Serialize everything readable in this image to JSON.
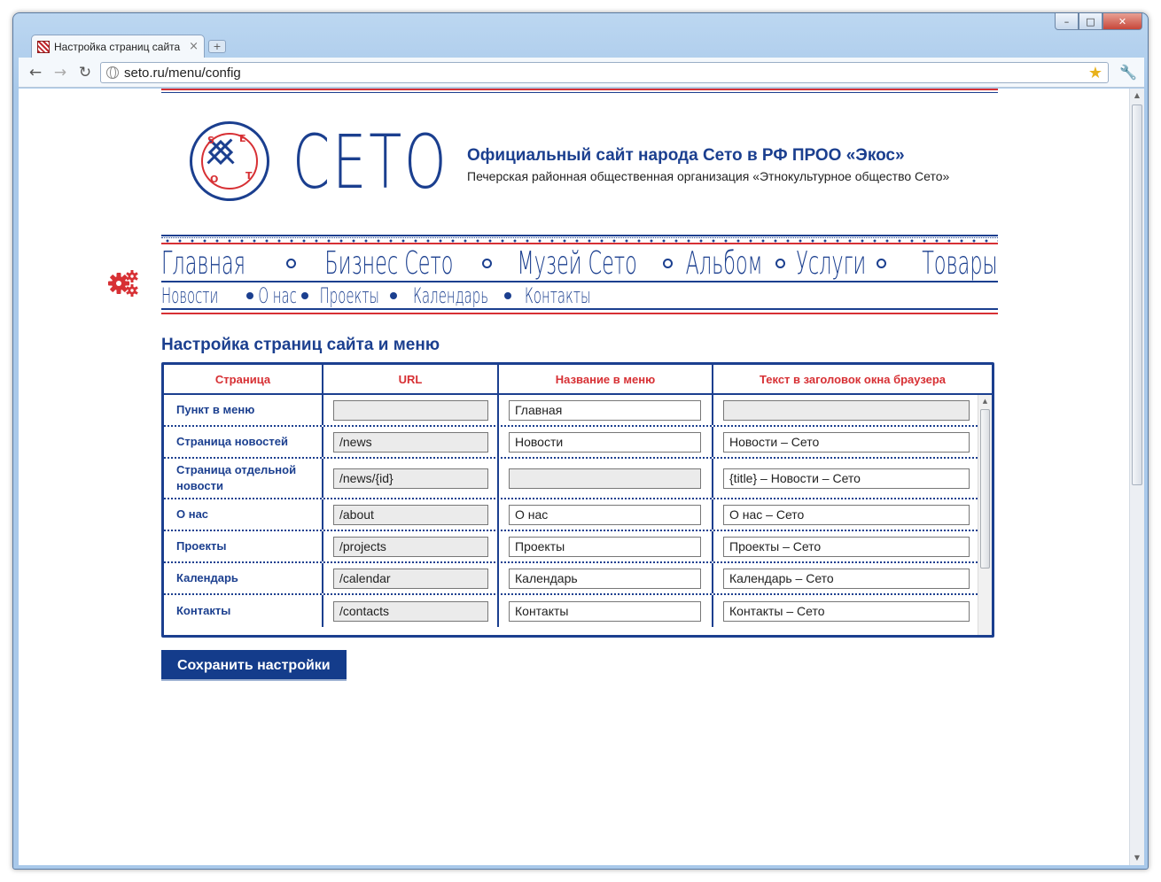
{
  "browser": {
    "tab_title": "Настройка страниц сайта",
    "tab_close": "×",
    "new_tab": "+",
    "url": "seto.ru/menu/config",
    "win_min": "–",
    "win_max": "□",
    "win_close": "✕",
    "back": "←",
    "forward": "→",
    "reload": "↻",
    "star": "★",
    "wrench": "🔧"
  },
  "site": {
    "wordmark": "СЕТО",
    "logo_letters": [
      "S",
      "E",
      "T",
      "O"
    ],
    "title": "Официальный сайт народа Сето в РФ ПРОО «Экос»",
    "subtitle": "Печерская районная общественная организация «Этнокультурное общество Сето»"
  },
  "main_menu": [
    "Главная",
    "Бизнес Сето",
    "Музей Сето",
    "Альбом",
    "Услуги",
    "Товары"
  ],
  "sub_menu": [
    "Новости",
    "О нас",
    "Проекты",
    "Календарь",
    "Контакты"
  ],
  "section_title": "Настройка страниц сайта и меню",
  "table": {
    "headers": [
      "Страница",
      "URL",
      "Название в меню",
      "Текст в заголовок окна браузера"
    ],
    "rows": [
      {
        "page": "Пункт в меню",
        "url": "",
        "menu": "Главная",
        "title": ""
      },
      {
        "page": "Страница новостей",
        "url": "/news",
        "menu": "Новости",
        "title": "Новости – Сето"
      },
      {
        "page": "Страница отдельной новости",
        "url": "/news/{id}",
        "menu": "",
        "title": "{title} – Новости – Сето"
      },
      {
        "page": "О нас",
        "url": "/about",
        "menu": "О нас",
        "title": "О нас – Сето"
      },
      {
        "page": "Проекты",
        "url": "/projects",
        "menu": "Проекты",
        "title": "Проекты – Сето"
      },
      {
        "page": "Календарь",
        "url": "/calendar",
        "menu": "Календарь",
        "title": "Календарь – Сето"
      },
      {
        "page": "Контакты",
        "url": "/contacts",
        "menu": "Контакты",
        "title": "Контакты – Сето"
      }
    ]
  },
  "save_button": "Сохранить настройки",
  "colors": {
    "brand_blue": "#1b3f8f",
    "accent_red": "#d73034",
    "button_blue": "#143c8b"
  },
  "icons": {
    "settings": "gear-icon",
    "logo": "seto-logo-icon"
  }
}
